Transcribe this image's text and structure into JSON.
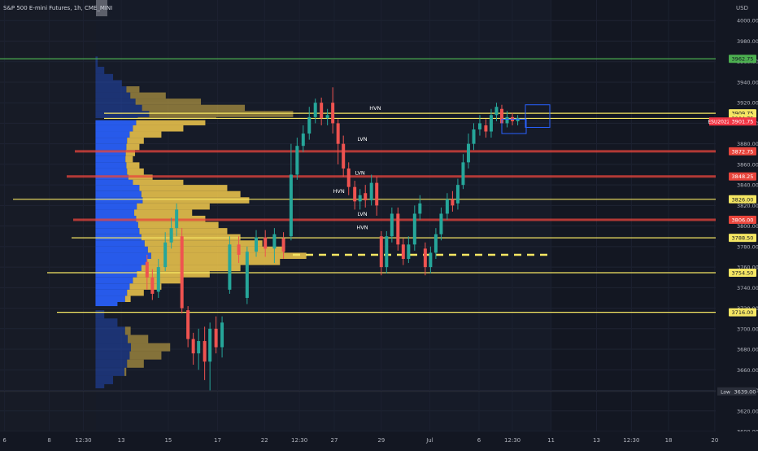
{
  "header": {
    "symbol_title": "S&P 500 E-mini Futures, 1h, CME_MINI"
  },
  "chart_data": {
    "type": "candlestick",
    "currency": "USD",
    "ylim": [
      3600,
      4020
    ],
    "y_ticks": [
      "4000.00",
      "3980.00",
      "3960.00",
      "3940.00",
      "3920.00",
      "3900.00",
      "3880.00",
      "3860.00",
      "3840.00",
      "3820.00",
      "3800.00",
      "3780.00",
      "3760.00",
      "3740.00",
      "3720.00",
      "3700.00",
      "3680.00",
      "3660.00",
      "3640.00",
      "3620.00",
      "3600.00"
    ],
    "x_ticks": [
      "6",
      "8",
      "12:30",
      "13",
      "15",
      "17",
      "22",
      "12:30",
      "27",
      "29",
      "Jul",
      "6",
      "12:30",
      "11",
      "13",
      "12:30",
      "18",
      "20"
    ],
    "levels": [
      {
        "value": 3962.75,
        "label": "3962.75",
        "color": "#4caf50",
        "kind": "green"
      },
      {
        "value": 3909.75,
        "label": "3909.75",
        "color": "#f5e663",
        "kind": "yellow"
      },
      {
        "value": 3904.75,
        "label": "3904.75",
        "color": "#f5e663",
        "kind": "yellow"
      },
      {
        "value": 3872.75,
        "label": "3872.75",
        "color": "#e8453c",
        "kind": "red"
      },
      {
        "value": 3848.25,
        "label": "3848.25",
        "color": "#e8453c",
        "kind": "red"
      },
      {
        "value": 3826.0,
        "label": "3826.00",
        "color": "#f5e663",
        "kind": "yellow"
      },
      {
        "value": 3806.0,
        "label": "3806.00",
        "color": "#e8453c",
        "kind": "red"
      },
      {
        "value": 3788.5,
        "label": "3788.50",
        "color": "#f5e663",
        "kind": "yellow"
      },
      {
        "value": 3754.5,
        "label": "3754.50",
        "color": "#f5e663",
        "kind": "yellow"
      },
      {
        "value": 3716.0,
        "label": "3716.00",
        "color": "#f5e663",
        "kind": "yellow"
      }
    ],
    "current_price": {
      "value": 3901.75,
      "label": "3901.75",
      "tag": "ESU2022"
    },
    "low": {
      "value": 3639.0,
      "label": "3639.00",
      "tag": "Low"
    },
    "poc": 3772,
    "annotations": [
      {
        "text": "HVN",
        "x": 0.495,
        "y": 3913
      },
      {
        "text": "LVN",
        "x": 0.478,
        "y": 3883
      },
      {
        "text": "LVN",
        "x": 0.475,
        "y": 3850
      },
      {
        "text": "HVN",
        "x": 0.447,
        "y": 3832
      },
      {
        "text": "LVN",
        "x": 0.478,
        "y": 3810
      },
      {
        "text": "HVN",
        "x": 0.478,
        "y": 3797
      }
    ],
    "candles": [
      {
        "x": 0.194,
        "o": 3765,
        "c": 3750,
        "h": 3772,
        "l": 3738
      },
      {
        "x": 0.201,
        "o": 3750,
        "c": 3734,
        "h": 3758,
        "l": 3728
      },
      {
        "x": 0.209,
        "o": 3736,
        "c": 3760,
        "h": 3768,
        "l": 3730
      },
      {
        "x": 0.218,
        "o": 3760,
        "c": 3784,
        "h": 3794,
        "l": 3756
      },
      {
        "x": 0.226,
        "o": 3784,
        "c": 3798,
        "h": 3808,
        "l": 3778
      },
      {
        "x": 0.233,
        "o": 3798,
        "c": 3816,
        "h": 3822,
        "l": 3790
      },
      {
        "x": 0.24,
        "o": 3790,
        "c": 3720,
        "h": 3798,
        "l": 3715
      },
      {
        "x": 0.248,
        "o": 3718,
        "c": 3690,
        "h": 3722,
        "l": 3682
      },
      {
        "x": 0.255,
        "o": 3690,
        "c": 3676,
        "h": 3696,
        "l": 3665
      },
      {
        "x": 0.262,
        "o": 3676,
        "c": 3688,
        "h": 3700,
        "l": 3660
      },
      {
        "x": 0.27,
        "o": 3688,
        "c": 3668,
        "h": 3702,
        "l": 3650
      },
      {
        "x": 0.277,
        "o": 3668,
        "c": 3700,
        "h": 3706,
        "l": 3640
      },
      {
        "x": 0.285,
        "o": 3700,
        "c": 3682,
        "h": 3712,
        "l": 3676
      },
      {
        "x": 0.293,
        "o": 3682,
        "c": 3706,
        "h": 3712,
        "l": 3672
      },
      {
        "x": 0.303,
        "o": 3738,
        "c": 3782,
        "h": 3790,
        "l": 3734
      },
      {
        "x": 0.315,
        "o": 3782,
        "c": 3772,
        "h": 3790,
        "l": 3764
      },
      {
        "x": 0.326,
        "o": 3730,
        "c": 3775,
        "h": 3780,
        "l": 3724
      },
      {
        "x": 0.338,
        "o": 3775,
        "c": 3789,
        "h": 3796,
        "l": 3770
      },
      {
        "x": 0.35,
        "o": 3789,
        "c": 3778,
        "h": 3796,
        "l": 3770
      },
      {
        "x": 0.362,
        "o": 3778,
        "c": 3792,
        "h": 3798,
        "l": 3764
      },
      {
        "x": 0.374,
        "o": 3788,
        "c": 3775,
        "h": 3794,
        "l": 3768
      },
      {
        "x": 0.384,
        "o": 3790,
        "c": 3850,
        "h": 3880,
        "l": 3786
      },
      {
        "x": 0.392,
        "o": 3850,
        "c": 3878,
        "h": 3886,
        "l": 3845
      },
      {
        "x": 0.4,
        "o": 3878,
        "c": 3890,
        "h": 3898,
        "l": 3872
      },
      {
        "x": 0.408,
        "o": 3890,
        "c": 3906,
        "h": 3916,
        "l": 3884
      },
      {
        "x": 0.416,
        "o": 3906,
        "c": 3920,
        "h": 3924,
        "l": 3900
      },
      {
        "x": 0.424,
        "o": 3920,
        "c": 3905,
        "h": 3925,
        "l": 3898
      },
      {
        "x": 0.432,
        "o": 3905,
        "c": 3908,
        "h": 3914,
        "l": 3898
      },
      {
        "x": 0.439,
        "o": 3920,
        "c": 3900,
        "h": 3935,
        "l": 3890
      },
      {
        "x": 0.446,
        "o": 3900,
        "c": 3880,
        "h": 3904,
        "l": 3860
      },
      {
        "x": 0.453,
        "o": 3880,
        "c": 3856,
        "h": 3888,
        "l": 3848
      },
      {
        "x": 0.46,
        "o": 3856,
        "c": 3838,
        "h": 3862,
        "l": 3830
      },
      {
        "x": 0.468,
        "o": 3838,
        "c": 3824,
        "h": 3844,
        "l": 3816
      },
      {
        "x": 0.475,
        "o": 3824,
        "c": 3830,
        "h": 3836,
        "l": 3816
      },
      {
        "x": 0.482,
        "o": 3832,
        "c": 3825,
        "h": 3840,
        "l": 3818
      },
      {
        "x": 0.49,
        "o": 3825,
        "c": 3842,
        "h": 3850,
        "l": 3820
      },
      {
        "x": 0.497,
        "o": 3842,
        "c": 3820,
        "h": 3848,
        "l": 3810
      },
      {
        "x": 0.503,
        "o": 3790,
        "c": 3760,
        "h": 3795,
        "l": 3752
      },
      {
        "x": 0.51,
        "o": 3760,
        "c": 3790,
        "h": 3795,
        "l": 3754
      },
      {
        "x": 0.517,
        "o": 3790,
        "c": 3812,
        "h": 3818,
        "l": 3784
      },
      {
        "x": 0.525,
        "o": 3812,
        "c": 3782,
        "h": 3818,
        "l": 3776
      },
      {
        "x": 0.532,
        "o": 3782,
        "c": 3768,
        "h": 3788,
        "l": 3762
      },
      {
        "x": 0.539,
        "o": 3768,
        "c": 3782,
        "h": 3790,
        "l": 3764
      },
      {
        "x": 0.547,
        "o": 3782,
        "c": 3812,
        "h": 3820,
        "l": 3776
      },
      {
        "x": 0.554,
        "o": 3812,
        "c": 3822,
        "h": 3830,
        "l": 3806
      },
      {
        "x": 0.561,
        "o": 3778,
        "c": 3760,
        "h": 3784,
        "l": 3752
      },
      {
        "x": 0.568,
        "o": 3760,
        "c": 3774,
        "h": 3780,
        "l": 3754
      },
      {
        "x": 0.575,
        "o": 3774,
        "c": 3792,
        "h": 3798,
        "l": 3768
      },
      {
        "x": 0.582,
        "o": 3792,
        "c": 3812,
        "h": 3818,
        "l": 3786
      },
      {
        "x": 0.59,
        "o": 3812,
        "c": 3826,
        "h": 3832,
        "l": 3806
      },
      {
        "x": 0.597,
        "o": 3826,
        "c": 3820,
        "h": 3834,
        "l": 3814
      },
      {
        "x": 0.604,
        "o": 3822,
        "c": 3840,
        "h": 3846,
        "l": 3816
      },
      {
        "x": 0.611,
        "o": 3840,
        "c": 3862,
        "h": 3870,
        "l": 3836
      },
      {
        "x": 0.618,
        "o": 3862,
        "c": 3880,
        "h": 3890,
        "l": 3856
      },
      {
        "x": 0.625,
        "o": 3880,
        "c": 3894,
        "h": 3900,
        "l": 3874
      },
      {
        "x": 0.633,
        "o": 3894,
        "c": 3900,
        "h": 3908,
        "l": 3888
      },
      {
        "x": 0.641,
        "o": 3898,
        "c": 3892,
        "h": 3904,
        "l": 3886
      },
      {
        "x": 0.648,
        "o": 3892,
        "c": 3908,
        "h": 3914,
        "l": 3886
      },
      {
        "x": 0.655,
        "o": 3908,
        "c": 3916,
        "h": 3920,
        "l": 3902
      },
      {
        "x": 0.662,
        "o": 3914,
        "c": 3900,
        "h": 3918,
        "l": 3894
      },
      {
        "x": 0.669,
        "o": 3900,
        "c": 3906,
        "h": 3912,
        "l": 3896
      },
      {
        "x": 0.676,
        "o": 3906,
        "c": 3902,
        "h": 3910,
        "l": 3898
      },
      {
        "x": 0.683,
        "o": 3902,
        "c": 3905,
        "h": 3908,
        "l": 3898
      }
    ],
    "profiles": [
      {
        "name": "upper",
        "x0": 0.126,
        "top": 3965,
        "bottom": 3905,
        "rows": [
          [
            3965,
            0.01
          ],
          [
            3955,
            0.04
          ],
          [
            3948,
            0.08
          ],
          [
            3942,
            0.12
          ],
          [
            3936,
            0.2
          ],
          [
            3930,
            0.32
          ],
          [
            3924,
            0.48
          ],
          [
            3918,
            0.68
          ],
          [
            3912,
            0.9
          ],
          [
            3906,
            0.55
          ]
        ]
      },
      {
        "name": "main",
        "x0": 0.126,
        "top": 3903,
        "bottom": 3722,
        "rows": [
          [
            3903,
            0.5
          ],
          [
            3898,
            0.4
          ],
          [
            3892,
            0.3
          ],
          [
            3886,
            0.22
          ],
          [
            3880,
            0.2
          ],
          [
            3874,
            0.18
          ],
          [
            3868,
            0.17
          ],
          [
            3862,
            0.2
          ],
          [
            3856,
            0.22
          ],
          [
            3850,
            0.26
          ],
          [
            3845,
            0.4
          ],
          [
            3840,
            0.6
          ],
          [
            3834,
            0.66
          ],
          [
            3828,
            0.7
          ],
          [
            3822,
            0.52
          ],
          [
            3816,
            0.44
          ],
          [
            3810,
            0.5
          ],
          [
            3804,
            0.56
          ],
          [
            3798,
            0.6
          ],
          [
            3792,
            0.66
          ],
          [
            3786,
            0.76
          ],
          [
            3780,
            0.86
          ],
          [
            3774,
            0.96
          ],
          [
            3768,
            0.84
          ],
          [
            3762,
            0.66
          ],
          [
            3756,
            0.52
          ],
          [
            3750,
            0.4
          ],
          [
            3744,
            0.3
          ],
          [
            3738,
            0.22
          ],
          [
            3732,
            0.16
          ],
          [
            3726,
            0.1
          ]
        ]
      },
      {
        "name": "lower",
        "x0": 0.126,
        "top": 3718,
        "bottom": 3642,
        "rows": [
          [
            3718,
            0.04
          ],
          [
            3710,
            0.1
          ],
          [
            3702,
            0.16
          ],
          [
            3694,
            0.24
          ],
          [
            3686,
            0.34
          ],
          [
            3678,
            0.3
          ],
          [
            3670,
            0.22
          ],
          [
            3662,
            0.14
          ],
          [
            3654,
            0.08
          ],
          [
            3646,
            0.04
          ]
        ]
      }
    ]
  }
}
